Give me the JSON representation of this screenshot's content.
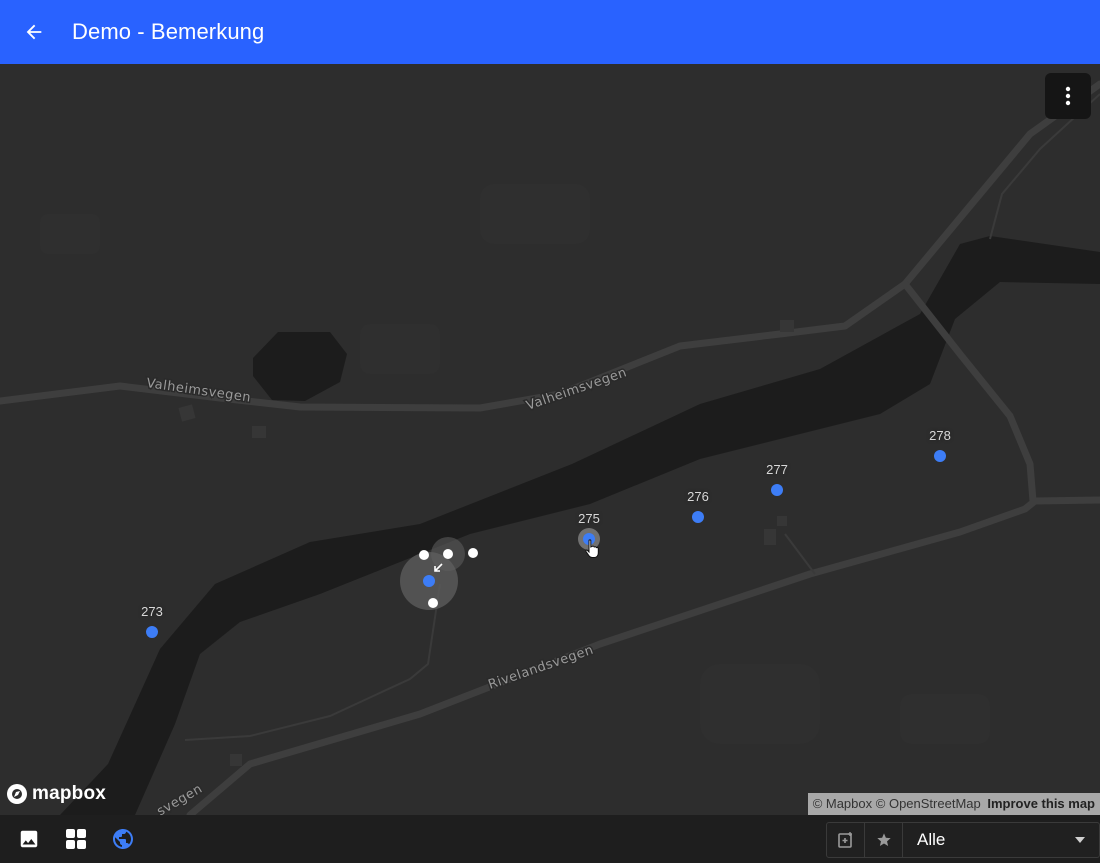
{
  "app": {
    "title": "Demo - Bemerkung",
    "back_icon": "arrow-left-icon",
    "accent_color": "#2962ff"
  },
  "map": {
    "roads": [
      {
        "name": "Valheimsvegen"
      },
      {
        "name": "Valheimsvegen"
      },
      {
        "name": "Rivelandsvegen"
      },
      {
        "name": "svegen"
      }
    ],
    "markers": [
      {
        "label": "273"
      },
      {
        "label": "275"
      },
      {
        "label": "276"
      },
      {
        "label": "277"
      },
      {
        "label": "278"
      }
    ],
    "marker_color": "#3d7df6",
    "menu_icon": "more-vertical-icon",
    "logo_text": "mapbox",
    "attribution": {
      "mapbox": "© Mapbox",
      "osm": "© OpenStreetMap",
      "improve": "Improve this map"
    }
  },
  "bottombar": {
    "icons": [
      "image-icon",
      "grid-icon",
      "globe-icon"
    ],
    "filter": {
      "add_icon": "add-note-icon",
      "star_icon": "star-icon",
      "selected": "Alle",
      "dropdown_icon": "caret-down-icon"
    }
  }
}
